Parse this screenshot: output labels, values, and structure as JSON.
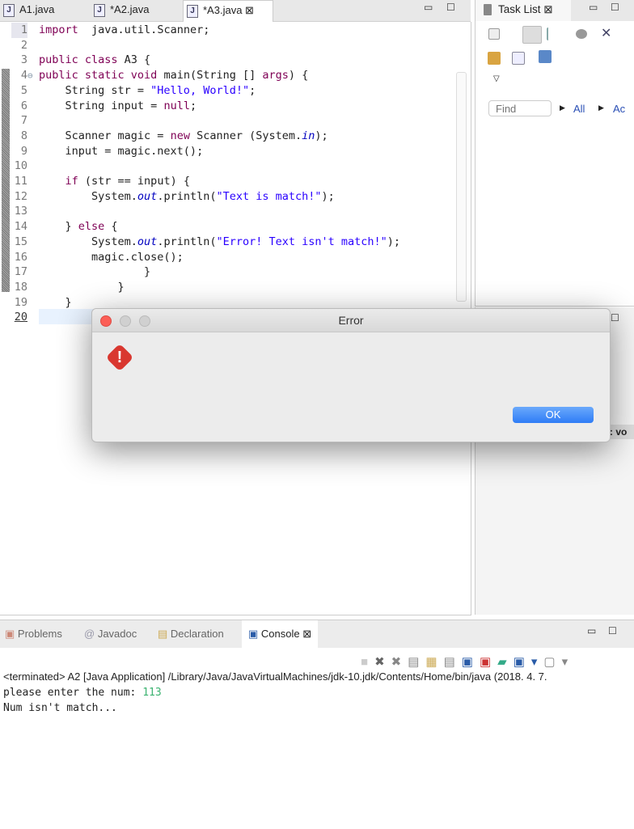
{
  "editor": {
    "tabs": [
      {
        "label": "A1.java",
        "active": false
      },
      {
        "label": "*A2.java",
        "active": false
      },
      {
        "label": "*A3.java",
        "active": true
      }
    ],
    "lines": [
      [
        [
          "kw",
          "import"
        ],
        [
          "",
          "  java.util.Scanner;"
        ]
      ],
      [],
      [
        [
          "kw",
          "public class"
        ],
        [
          "",
          " A3 {"
        ]
      ],
      [
        [
          "kw",
          "public static void"
        ],
        [
          "",
          " main(String [] "
        ],
        [
          "kw",
          "args"
        ],
        [
          "",
          ") {"
        ]
      ],
      [
        [
          "",
          "    String str = "
        ],
        [
          "str",
          "\"Hello, World!\""
        ],
        [
          "",
          ";"
        ]
      ],
      [
        [
          "",
          "    String input = "
        ],
        [
          "kw",
          "null"
        ],
        [
          "",
          ";"
        ]
      ],
      [],
      [
        [
          "",
          "    Scanner magic = "
        ],
        [
          "kw",
          "new"
        ],
        [
          "",
          " Scanner (System."
        ],
        [
          "fld",
          "in"
        ],
        [
          "",
          ");"
        ]
      ],
      [
        [
          "",
          "    input = magic.next();"
        ]
      ],
      [],
      [
        [
          "",
          "    "
        ],
        [
          "kw",
          "if"
        ],
        [
          "",
          " (str == input) {"
        ]
      ],
      [
        [
          "",
          "        System."
        ],
        [
          "fld",
          "out"
        ],
        [
          "",
          ".println("
        ],
        [
          "str",
          "\"Text is match!\""
        ],
        [
          "",
          ");"
        ]
      ],
      [],
      [
        [
          "",
          "    } "
        ],
        [
          "kw",
          "else"
        ],
        [
          "",
          " {"
        ]
      ],
      [
        [
          "",
          "        System."
        ],
        [
          "fld",
          "out"
        ],
        [
          "",
          ".println("
        ],
        [
          "str",
          "\"Error! Text isn't match!\""
        ],
        [
          "",
          ");"
        ]
      ],
      [
        [
          "",
          "        magic.close();"
        ]
      ],
      [
        [
          "",
          "                }"
        ]
      ],
      [
        [
          "",
          "            }"
        ]
      ],
      [
        [
          "",
          "    }"
        ]
      ],
      []
    ]
  },
  "task_list": {
    "title": "Task List",
    "find_placeholder": "Find",
    "all_label": "All",
    "activate_label": "Ac"
  },
  "side_fragment": ": vo",
  "console": {
    "tabs": [
      "Problems",
      "Javadoc",
      "Declaration",
      "Console"
    ],
    "status": "<terminated> A2 [Java Application] /Library/Java/JavaVirtualMachines/jdk-10.jdk/Contents/Home/bin/java (2018. 4. 7.",
    "prompt": "please enter the num: ",
    "input": "113",
    "output": "Num isn't match..."
  },
  "dialog": {
    "title": "Error",
    "ok_label": "OK"
  },
  "colors": {
    "keyword": "#7f0055",
    "string": "#2a00ff",
    "field": "#0000c0",
    "input": "#3cb371",
    "ok": "#3d86f7",
    "error_icon": "#d9372f"
  }
}
